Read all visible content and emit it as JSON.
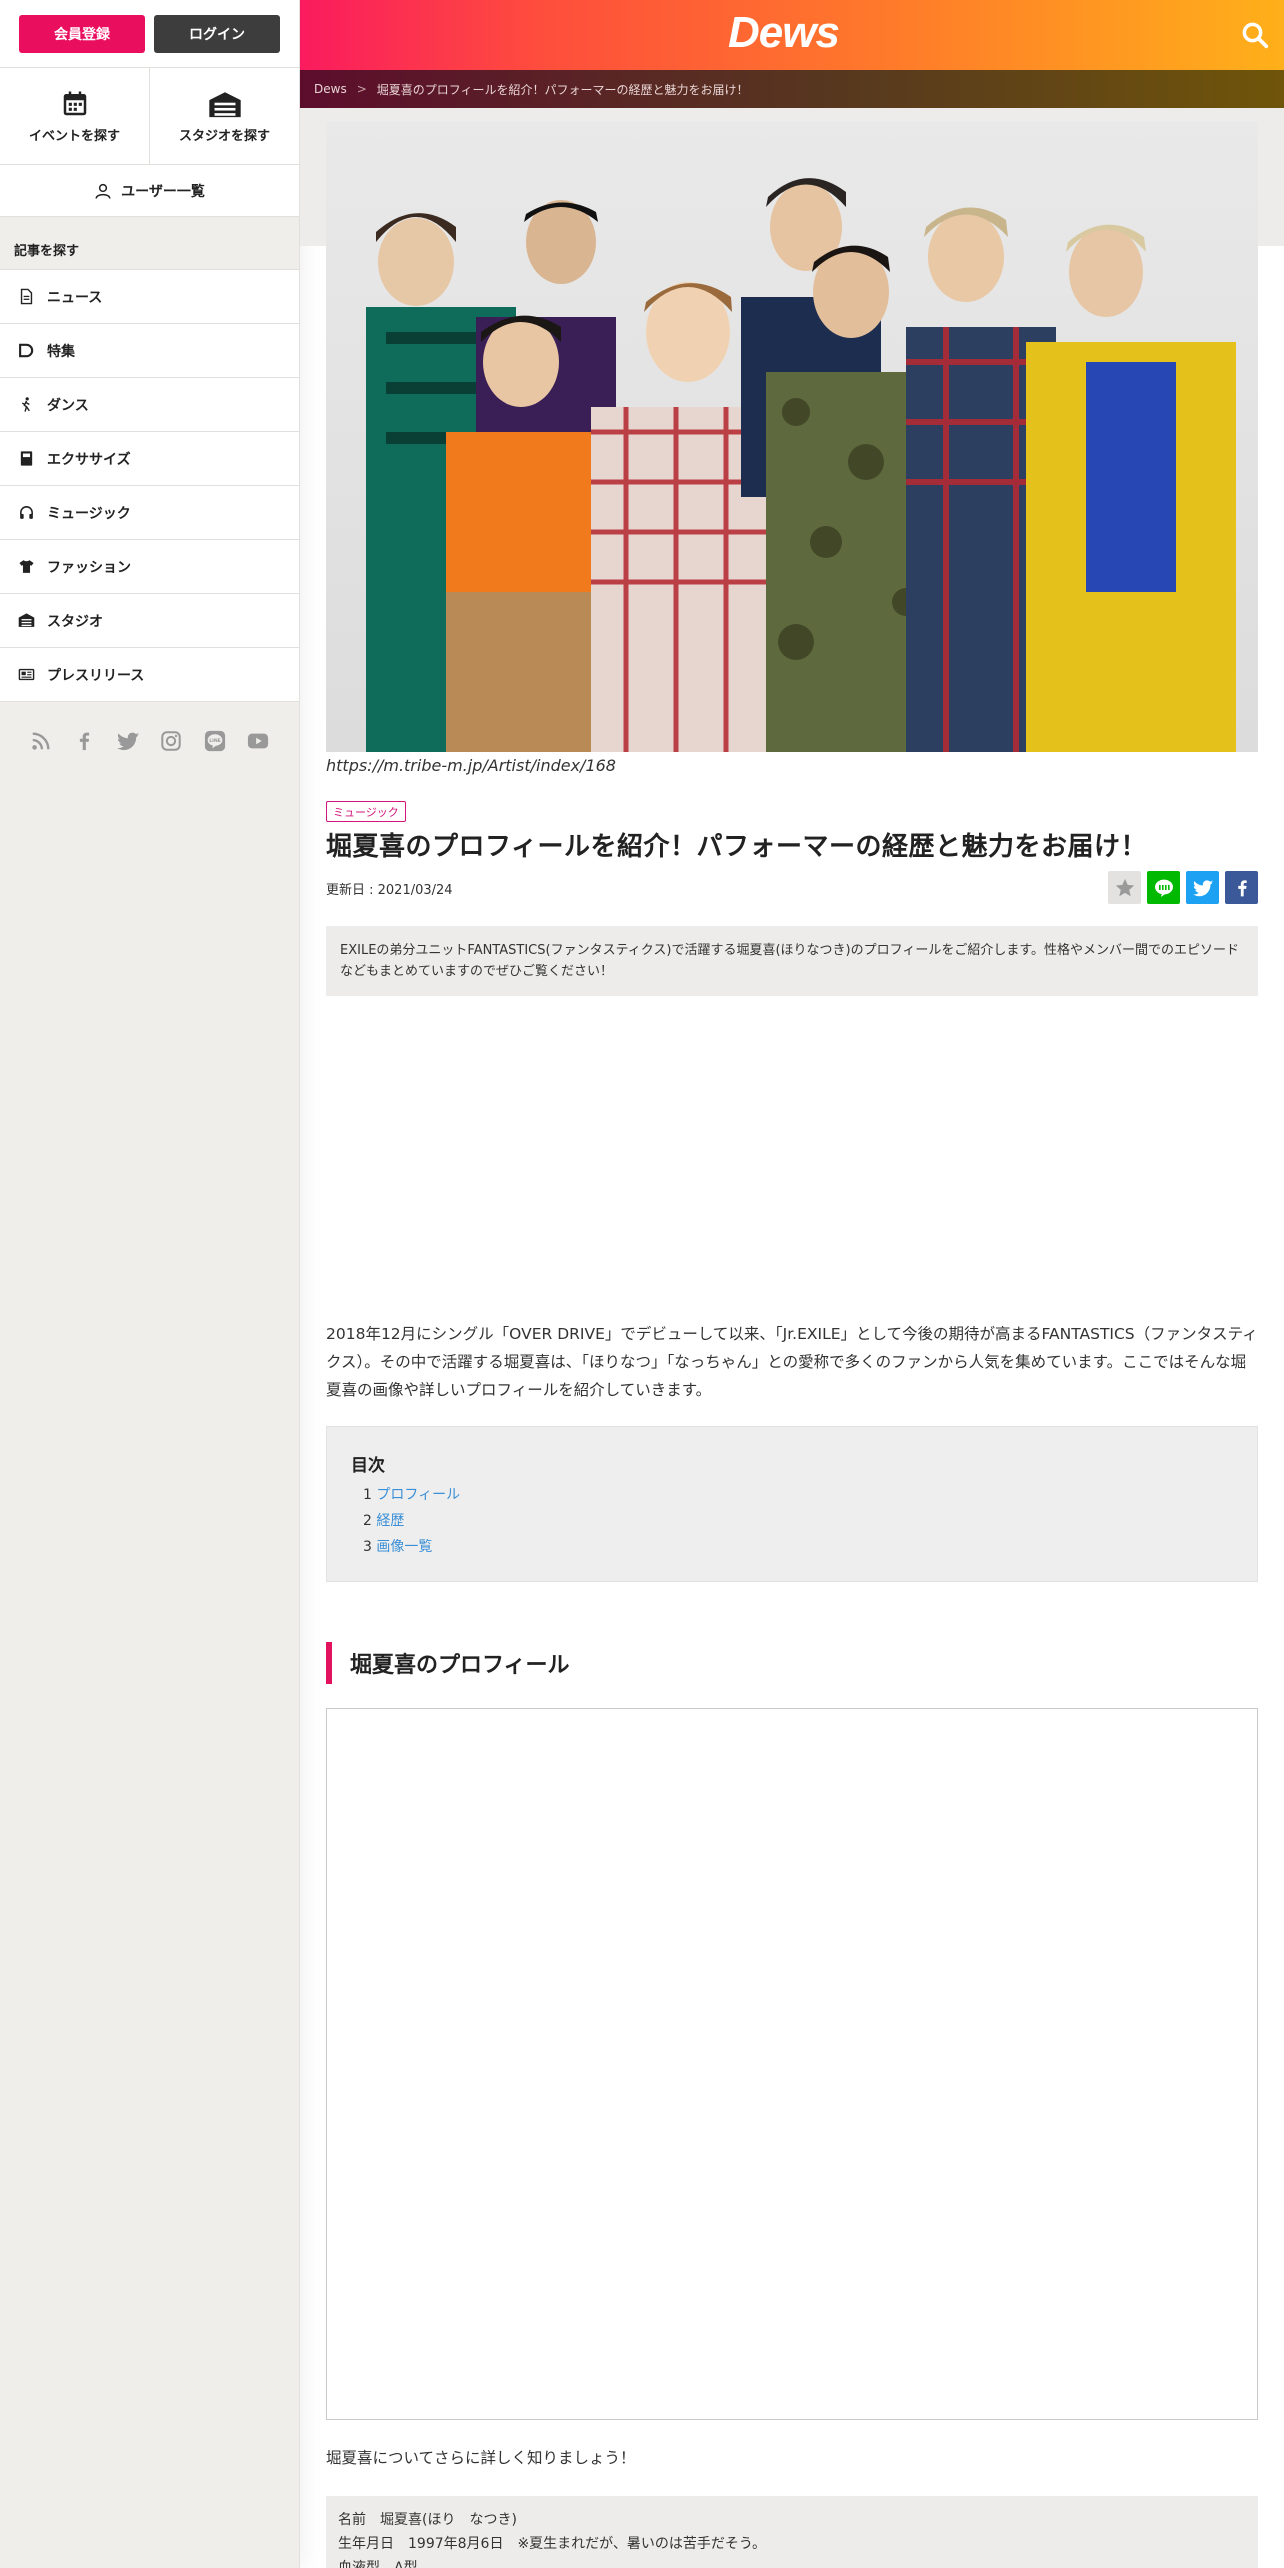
{
  "auth": {
    "register": "会員登録",
    "login": "ログイン"
  },
  "find": {
    "events": "イベントを探す",
    "studios": "スタジオを探す"
  },
  "user_list": "ユーザー一覧",
  "side_heading": "記事を探す",
  "categories": [
    {
      "label": "ニュース",
      "icon": "document-icon"
    },
    {
      "label": "特集",
      "icon": "tag-icon"
    },
    {
      "label": "ダンス",
      "icon": "dancer-icon"
    },
    {
      "label": "エクササイズ",
      "icon": "book-icon"
    },
    {
      "label": "ミュージック",
      "icon": "headphones-icon"
    },
    {
      "label": "ファッション",
      "icon": "shirt-icon"
    },
    {
      "label": "スタジオ",
      "icon": "garage-icon"
    },
    {
      "label": "プレスリリース",
      "icon": "newspaper-icon"
    }
  ],
  "social": [
    "rss-icon",
    "facebook-icon",
    "twitter-icon",
    "instagram-icon",
    "line-icon",
    "youtube-icon"
  ],
  "header": {
    "logo": "Dews"
  },
  "breadcrumb": {
    "home": "Dews",
    "separator": ">",
    "current": "堀夏喜のプロフィールを紹介！パフォーマーの経歴と魅力をお届け！"
  },
  "article": {
    "image_caption": "https://m.tribe-m.jp/Artist/index/168",
    "category": "ミュージック",
    "title": "堀夏喜のプロフィールを紹介！パフォーマーの経歴と魅力をお届け！",
    "updated": "更新日 : 2021/03/24",
    "lead": "EXILEの弟分ユニットFANTASTICS(ファンタスティクス)で活躍する堀夏喜(ほりなつき)のプロフィールをご紹介します。性格やメンバー間でのエピソードなどもまとめていますのでぜひご覧ください！",
    "intro": "2018年12月にシングル「OVER DRIVE」でデビューして以来、「Jr.EXILE」として今後の期待が高まるFANTASTICS（ファンタスティクス）。その中で活躍する堀夏喜は、「ほりなつ」「なっちゃん」との愛称で多くのファンから人気を集めています。ここではそんな堀夏喜の画像や詳しいプロフィールを紹介していきます。",
    "toc_title": "目次",
    "toc": [
      {
        "num": "1",
        "label": "プロフィール"
      },
      {
        "num": "2",
        "label": "経歴"
      },
      {
        "num": "3",
        "label": "画像一覧"
      }
    ],
    "section_heading": "堀夏喜のプロフィール",
    "more_text": "堀夏喜についてさらに詳しく知りましょう！",
    "profile_lines": [
      "名前　堀夏喜(ほり　なつき)",
      "生年月日　1997年8月6日　※夏生まれだが、暑いのは苦手だそう。",
      "血液型　A型"
    ]
  },
  "colors": {
    "accent": "#ea0f5e",
    "link": "#3b8fd6",
    "line": "#00b900",
    "twitter": "#1da1f2",
    "facebook": "#3b5998"
  }
}
